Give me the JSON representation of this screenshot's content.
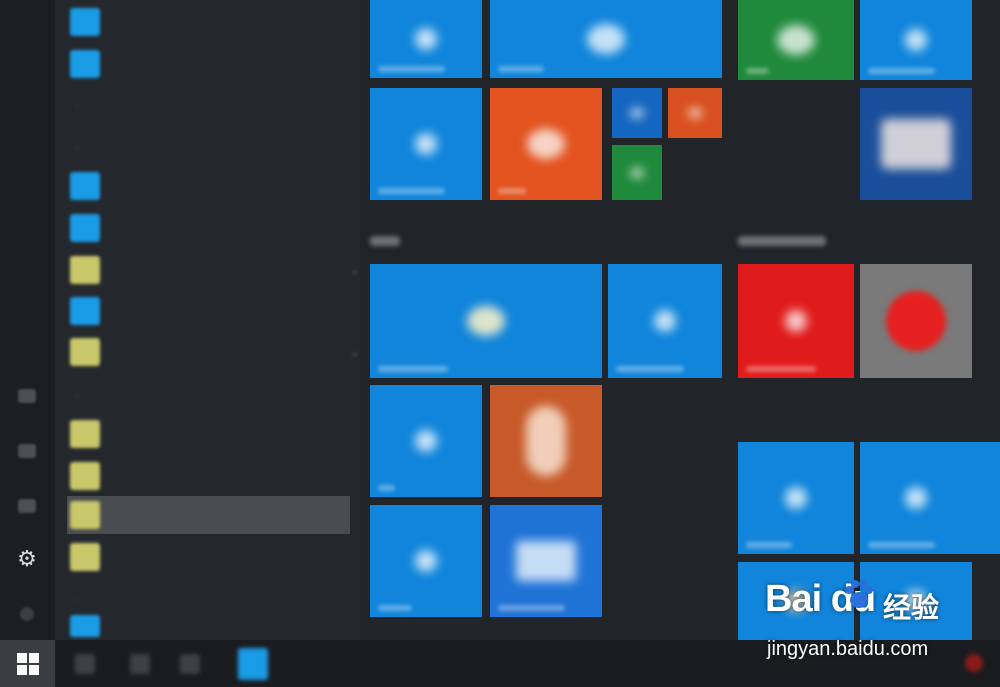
{
  "taskbar": {
    "start_icon": "windows-logo-icon"
  },
  "rail": {
    "settings_icon": "gear-icon"
  },
  "app_list": {
    "items": [
      {
        "label": "",
        "icon": "app-icon"
      },
      {
        "label": "",
        "icon": "app-icon"
      },
      {
        "label": "",
        "icon": "app-icon"
      },
      {
        "label": "",
        "icon": "app-icon"
      },
      {
        "label": "",
        "icon": "folder-icon"
      },
      {
        "label": "",
        "icon": "folder-icon"
      },
      {
        "label": "",
        "icon": "app-icon"
      },
      {
        "label": "",
        "icon": "folder-icon"
      },
      {
        "label": "",
        "icon": "folder-icon"
      },
      {
        "label": "",
        "icon": "folder-icon"
      },
      {
        "label": "",
        "icon": "folder-icon"
      },
      {
        "label": "",
        "icon": "app-icon"
      }
    ]
  },
  "tiles": {
    "colors": {
      "blue": "#1085db",
      "orange": "#e2531f",
      "green": "#1f8a3b",
      "red": "#e01b1b",
      "gray": "#7a7a7a"
    }
  },
  "watermark": {
    "logo_text": "Bai  du",
    "cn_text": "经验",
    "url": "jingyan.baidu.com"
  }
}
